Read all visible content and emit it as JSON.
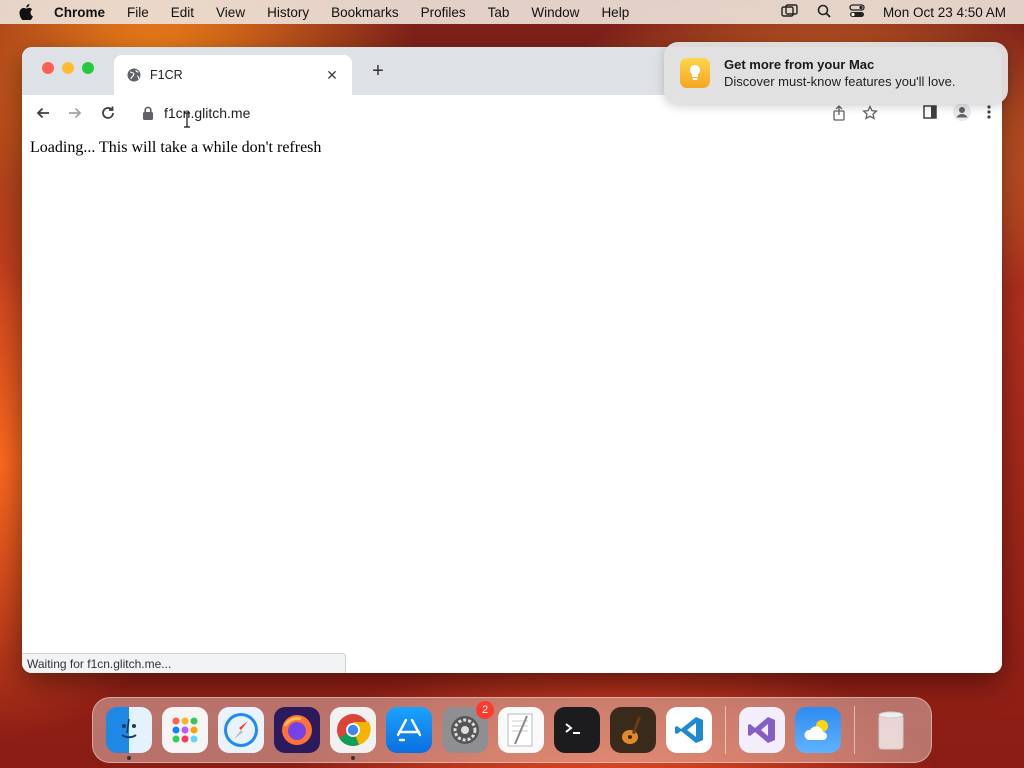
{
  "menubar": {
    "app_name": "Chrome",
    "items": [
      "File",
      "Edit",
      "View",
      "History",
      "Bookmarks",
      "Profiles",
      "Tab",
      "Window",
      "Help"
    ],
    "clock": "Mon Oct 23  4:50 AM"
  },
  "browser": {
    "tab_title": "F1CR",
    "url": "f1cn.glitch.me",
    "page_text": "Loading... This will take a while don't refresh",
    "status_text": "Waiting for f1cn.glitch.me..."
  },
  "notification": {
    "title": "Get more from your Mac",
    "body": "Discover must-know features you'll love."
  },
  "dock": {
    "settings_badge": "2",
    "apps": [
      "finder",
      "launchpad",
      "safari",
      "firefox",
      "chrome",
      "app-store",
      "system-settings",
      "textedit",
      "terminal",
      "garageband",
      "vscode",
      "visual-studio",
      "weather",
      "trash"
    ]
  }
}
